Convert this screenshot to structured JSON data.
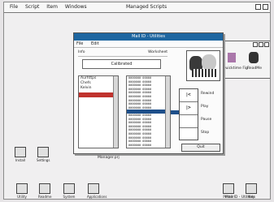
{
  "menubar": {
    "items": [
      "File",
      "Script",
      "Item",
      "Windows"
    ],
    "title": "Managed Scripts"
  },
  "dialog": {
    "title": "Mail ID - Utilities",
    "menu": [
      "File",
      "Edit"
    ],
    "row_left": "Info",
    "row_right": "Worksheet",
    "field_value": "Calibrated",
    "listA": [
      "Aurhttps",
      "Chefs",
      "Kelvin"
    ],
    "listB": [
      "0000000 00000",
      "0000000 00000",
      "0000000 00000",
      "0000000 00000",
      "0000000 00000",
      "0000000 00000",
      "0000000 00000",
      "0000000 00000",
      "0000000 00000",
      "0000000 00000",
      "0000000 00000",
      "0000000 00000",
      "0000000 00000",
      "0000000 00000",
      "0000000 00000",
      "0000000 00000",
      "0000000 00000",
      "0000000 00000",
      "0000000 00000"
    ],
    "buttons": [
      {
        "symbol": "|<",
        "label": "Rewind"
      },
      {
        "symbol": "|>",
        "label": "Play"
      },
      {
        "symbol": "",
        "label": "Pause"
      },
      {
        "symbol": "",
        "label": "Stop"
      }
    ],
    "footer_button": "Quit"
  },
  "side_window": {
    "label1": "Quicktime Fig",
    "label2": "ReadMe"
  },
  "desktop_icons": [
    "Install",
    "Settings",
    "Utility",
    "Readme",
    "System",
    "Printer",
    "Help",
    "Applications"
  ],
  "captions": {
    "under_dialog": "Manager.prj",
    "bottom_right": "Mail ID - Utilities"
  }
}
